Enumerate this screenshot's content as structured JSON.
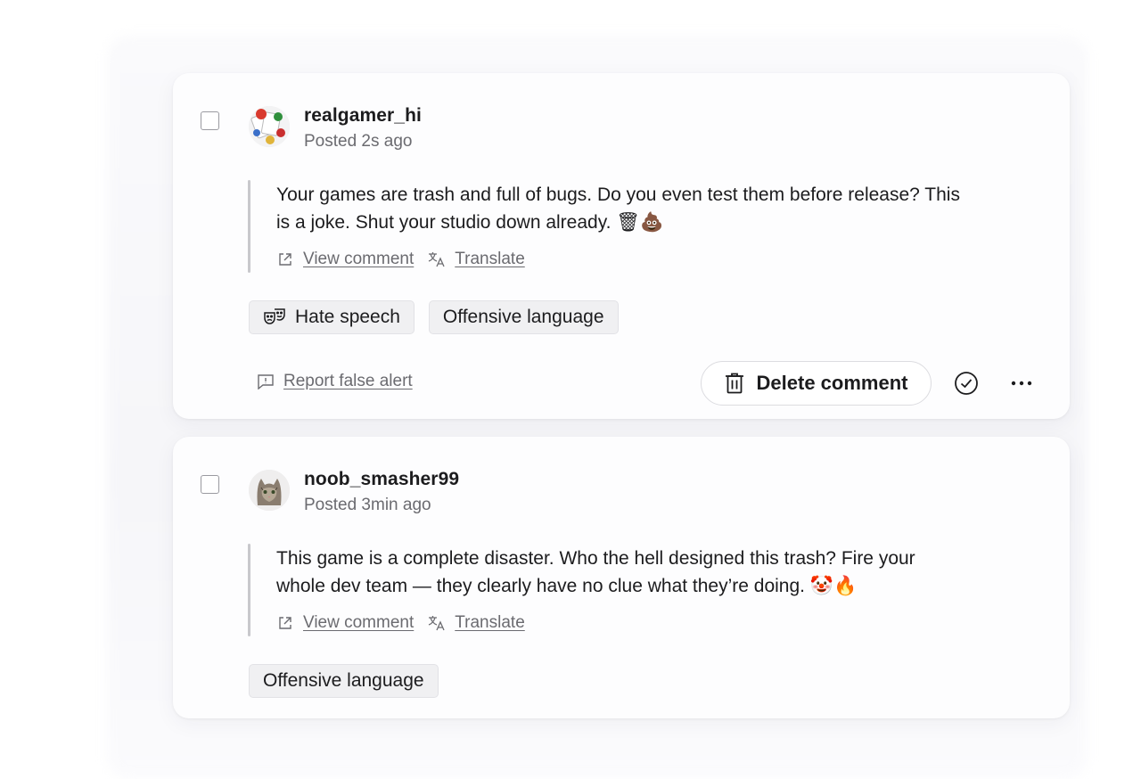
{
  "comments": [
    {
      "username": "realgamer_hi",
      "posted": "Posted 2s ago",
      "text_line1": "Your games are trash and full of bugs. Do you even test them before release? This",
      "text_line2": "is a joke. Shut your studio down already.",
      "emojis": "🗑💩",
      "view_label": "View comment",
      "translate_label": "Translate",
      "tags": [
        "Hate speech",
        "Offensive language"
      ],
      "tag_icons": [
        "theater-masks-icon",
        null
      ],
      "report_label": "Report false alert",
      "delete_label": "Delete comment"
    },
    {
      "username": "noob_smasher99",
      "posted": "Posted 3min ago",
      "text_line1": "This game is a complete disaster. Who the hell designed this trash? Fire your",
      "text_line2": "whole dev team — they clearly have no clue what they’re doing.",
      "emojis": "🤡🔥",
      "view_label": "View comment",
      "translate_label": "Translate",
      "tags": [
        "Offensive language"
      ]
    }
  ],
  "colors": {
    "card_bg": "#fdfdfe",
    "text_primary": "#1c1c1e",
    "text_secondary": "#6b6b70",
    "tag_bg": "#f0f0f2",
    "quote_bar": "#c8c8cc"
  }
}
